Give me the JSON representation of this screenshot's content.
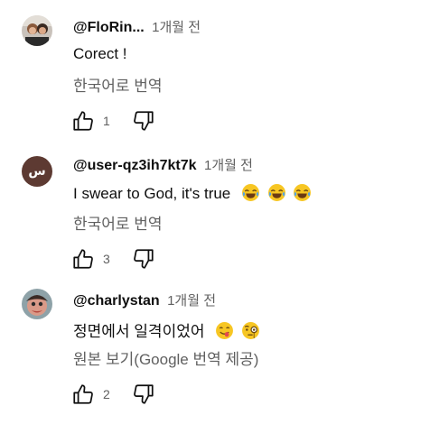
{
  "comments": [
    {
      "author": "@FloRin...",
      "time": "1개월 전",
      "text": "Corect !",
      "translate": "한국어로 번역",
      "likes": "1",
      "avatar": "photo"
    },
    {
      "author": "@user-qz3ih7kt7k",
      "time": "1개월 전",
      "text": "I swear to God, it's true",
      "emojis": [
        "face-with-tears-of-joy",
        "face-with-tears-of-joy",
        "face-with-tears-of-joy"
      ],
      "translate": "한국어로 번역",
      "likes": "3",
      "avatar_letter": "س",
      "avatar_color": "#5d3a32"
    },
    {
      "author": "@charlystan",
      "time": "1개월 전",
      "text": "정면에서 일격이었어",
      "emojis": [
        "face-savoring-food",
        "face-with-monocle"
      ],
      "translate": "원본 보기(Google 번역 제공)",
      "likes": "2",
      "avatar": "photo"
    }
  ]
}
